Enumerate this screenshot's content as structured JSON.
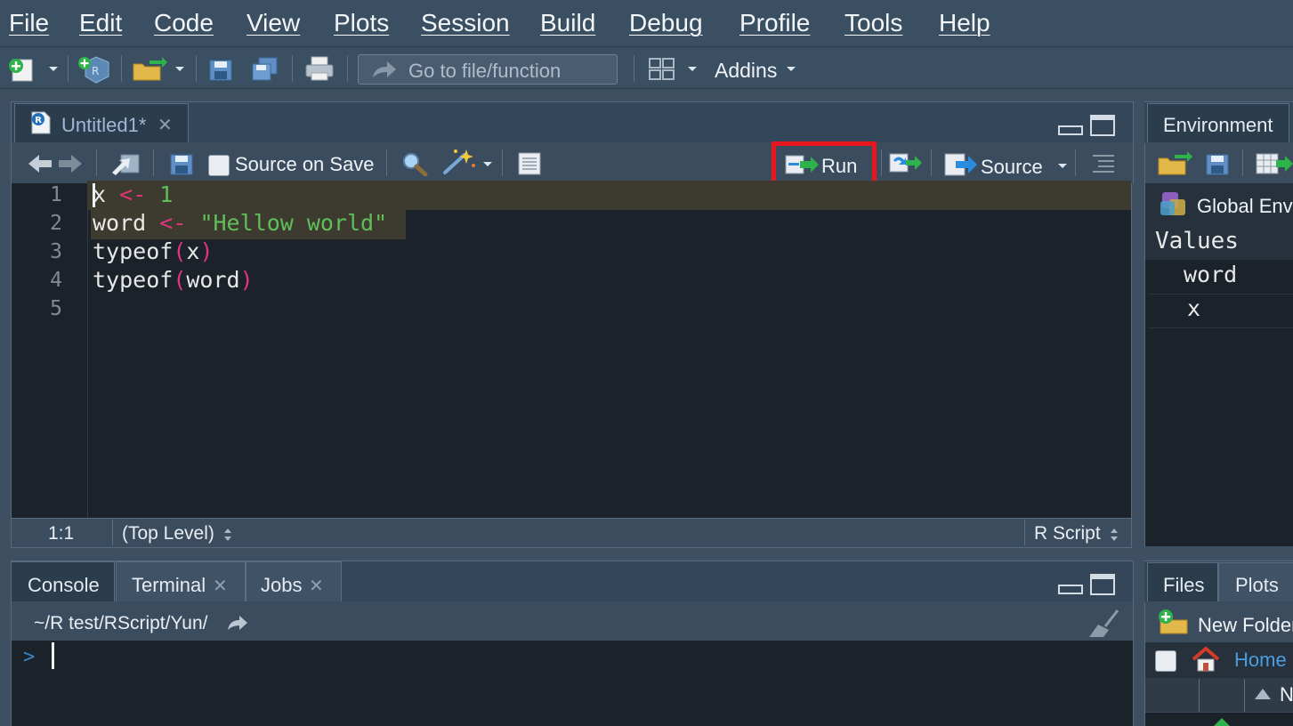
{
  "menubar": {
    "items": [
      "File",
      "Edit",
      "Code",
      "View",
      "Plots",
      "Session",
      "Build",
      "Debug",
      "Profile",
      "Tools",
      "Help"
    ]
  },
  "toolbar": {
    "goto_placeholder": "Go to file/function",
    "addins_label": "Addins"
  },
  "editor": {
    "tab_title": "Untitled1*",
    "source_on_save_label": "Source on Save",
    "run_label": "Run",
    "source_label": "Source",
    "lines": [
      "1",
      "2",
      "3",
      "4",
      "5"
    ],
    "code": [
      {
        "a": "x",
        "op": " <- ",
        "b": "1"
      },
      {
        "a": "word",
        "op": " <- ",
        "b": "\"Hellow world\""
      },
      {
        "fn": "typeof",
        "arg": "x"
      },
      {
        "fn": "typeof",
        "arg": "word"
      }
    ],
    "paren_open": "(",
    "paren_close": ")",
    "status_position": "1:1",
    "status_scope": "(Top Level)",
    "status_type": "R Script"
  },
  "console": {
    "tabs": [
      "Console",
      "Terminal",
      "Jobs"
    ],
    "path": "~/R test/RScript/Yun/",
    "prompt": ">"
  },
  "environment": {
    "tab": "Environment",
    "scope": "Global Envi",
    "section": "Values",
    "items": [
      "word",
      "x"
    ]
  },
  "files": {
    "tabs": [
      "Files",
      "Plots"
    ],
    "new_folder_label": "New Folder",
    "home_label": "Home",
    "sort_label": "N"
  },
  "colors": {
    "highlight_box": "#e8161d",
    "accent_green": "#2db34a",
    "accent_blue": "#2a8be0"
  }
}
